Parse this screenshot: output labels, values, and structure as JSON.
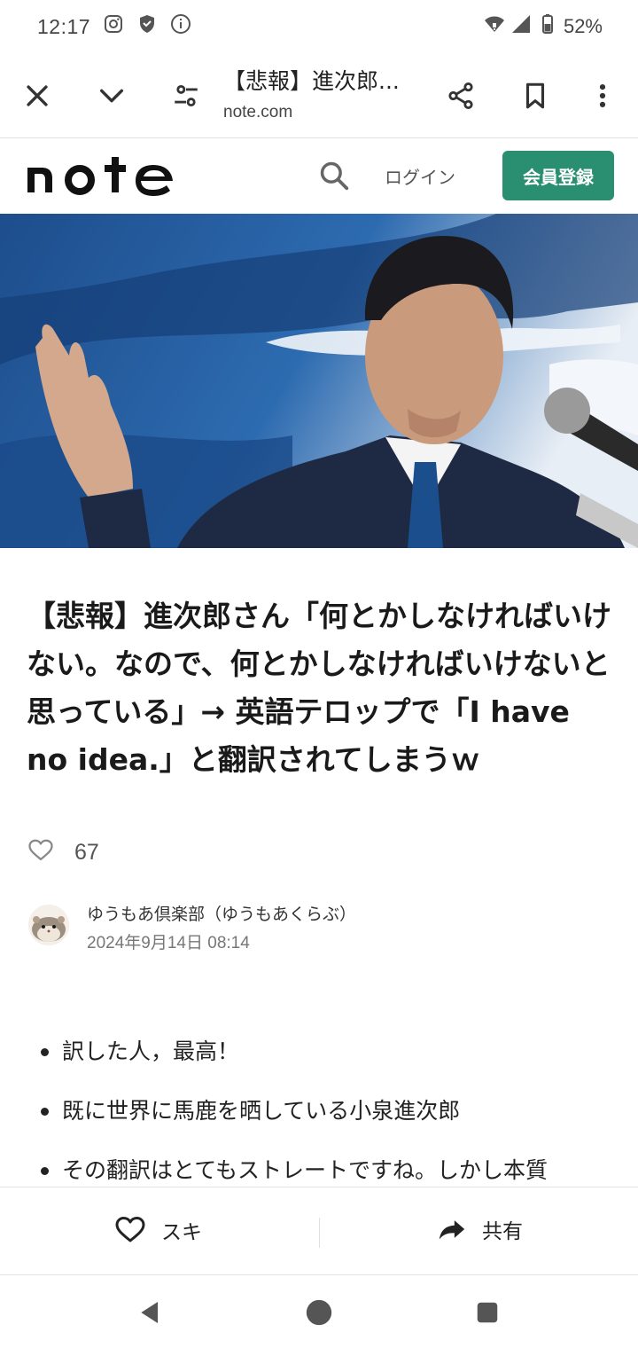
{
  "status_bar": {
    "time": "12:17",
    "battery": "52%",
    "icons": [
      "instagram-icon",
      "shield-icon",
      "info-icon",
      "wifi-icon",
      "signal-icon",
      "battery-icon"
    ]
  },
  "toolbar": {
    "title": "【悲報】進次郎...",
    "url": "note.com",
    "icons": [
      "close-icon",
      "chevron-down-icon",
      "page-settings-icon",
      "share-icon",
      "bookmark-icon",
      "more-vert-icon"
    ]
  },
  "header": {
    "logo": "note",
    "login_label": "ログイン",
    "signup_label": "会員登録",
    "accent_color": "#2a8f70"
  },
  "article": {
    "title": "【悲報】進次郎さん「何とかしなければいけない。なので、何とかしなければいけないと思っている」→ 英語テロップで「I have no idea.」と翻訳されてしまうｗ",
    "likes": "67",
    "author": "ゆうもあ倶楽部（ゆうもあくらぶ）",
    "date": "2024年9月14日 08:14",
    "bullets": [
      "訳した人，最高！",
      "既に世界に馬鹿を晒している小泉進次郎",
      "その翻訳はとてもストレートですね。しかし本質"
    ]
  },
  "action_bar": {
    "like_label": "スキ",
    "share_label": "共有"
  },
  "nav_bar": {
    "icons": [
      "back-icon",
      "home-icon",
      "recents-icon"
    ]
  }
}
